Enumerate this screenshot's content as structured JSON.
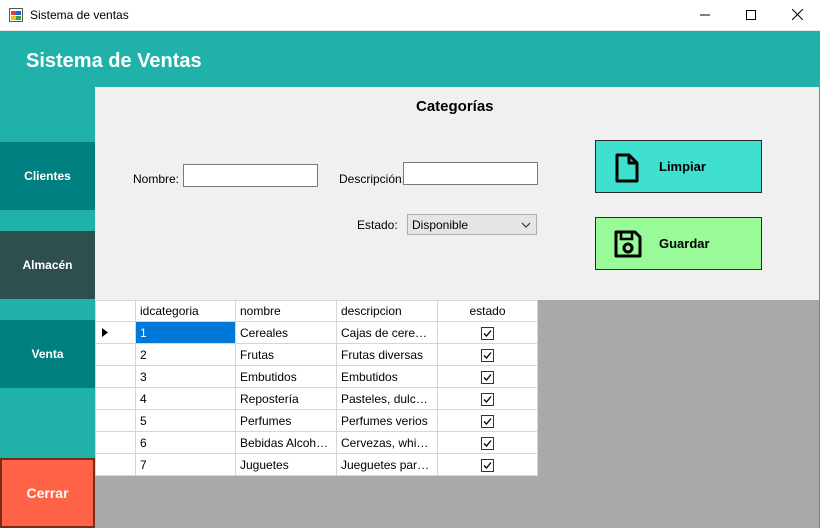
{
  "window": {
    "title": "Sistema de ventas",
    "icons": {
      "app": "app-form-icon",
      "minimize": "minimize-icon",
      "maximize": "maximize-icon",
      "close": "close-icon"
    }
  },
  "header": {
    "title": "Sistema de Ventas"
  },
  "sidebar": {
    "items": [
      {
        "label": "Clientes"
      },
      {
        "label": "Almacén"
      },
      {
        "label": "Venta"
      },
      {
        "label": "Cerrar"
      }
    ]
  },
  "form": {
    "title": "Categorías",
    "nombre_label": "Nombre:",
    "nombre_value": "",
    "descripcion_label": "Descripción:",
    "descripcion_value": "",
    "estado_label": "Estado:",
    "estado_value": "Disponible",
    "limpiar_label": "Limpiar",
    "guardar_label": "Guardar"
  },
  "grid": {
    "columns": [
      "idcategoria",
      "nombre",
      "descripcion",
      "estado"
    ],
    "rows": [
      {
        "id": "1",
        "nombre": "Cereales",
        "descripcion": "Cajas de cereales",
        "estado": true,
        "selected": true
      },
      {
        "id": "2",
        "nombre": "Frutas",
        "descripcion": "Frutas diversas",
        "estado": true
      },
      {
        "id": "3",
        "nombre": "Embutidos",
        "descripcion": "Embutidos",
        "estado": true
      },
      {
        "id": "4",
        "nombre": "Repostería",
        "descripcion": "Pasteles, dulces, ...",
        "estado": true
      },
      {
        "id": "5",
        "nombre": "Perfumes",
        "descripcion": "Perfumes verios",
        "estado": true
      },
      {
        "id": "6",
        "nombre": "Bebidas Alcoholi...",
        "descripcion": "Cervezas, whisky...",
        "estado": true
      },
      {
        "id": "7",
        "nombre": "Juguetes",
        "descripcion": "Jueguetes para n...",
        "estado": true
      }
    ]
  },
  "colors": {
    "header": "#20b2aa",
    "nav_dark": "#008080",
    "nav_almacen": "#2f4f4f",
    "cerrar": "#ff6347",
    "limpiar": "#40e0d0",
    "guardar": "#98fb98",
    "selection": "#0078d7"
  }
}
